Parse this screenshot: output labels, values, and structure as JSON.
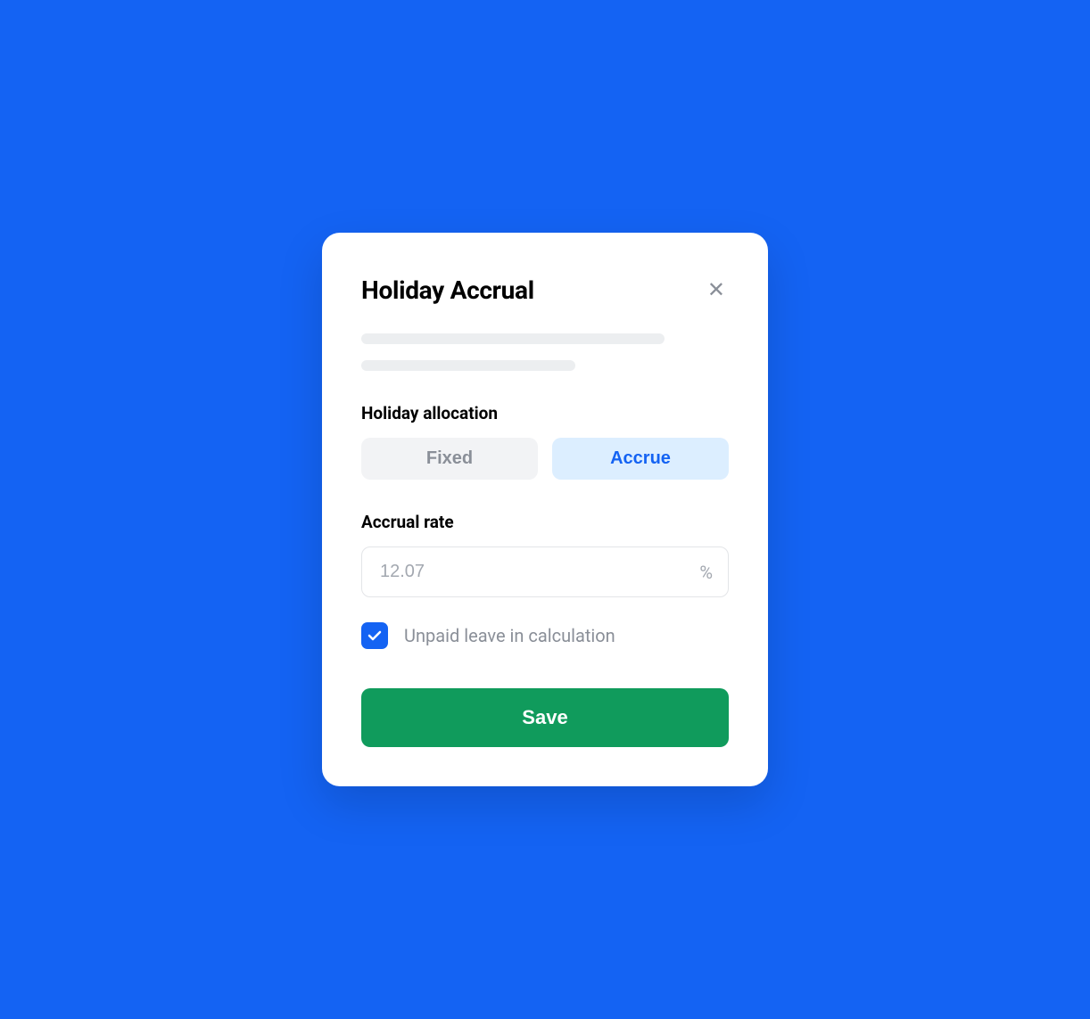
{
  "modal": {
    "title": "Holiday Accrual",
    "section_allocation_label": "Holiday allocation",
    "toggle": {
      "fixed": "Fixed",
      "accrue": "Accrue"
    },
    "section_rate_label": "Accrual rate",
    "rate_input": {
      "placeholder": "12.07",
      "suffix": "%"
    },
    "checkbox_label": "Unpaid leave in calculation",
    "save_label": "Save"
  }
}
